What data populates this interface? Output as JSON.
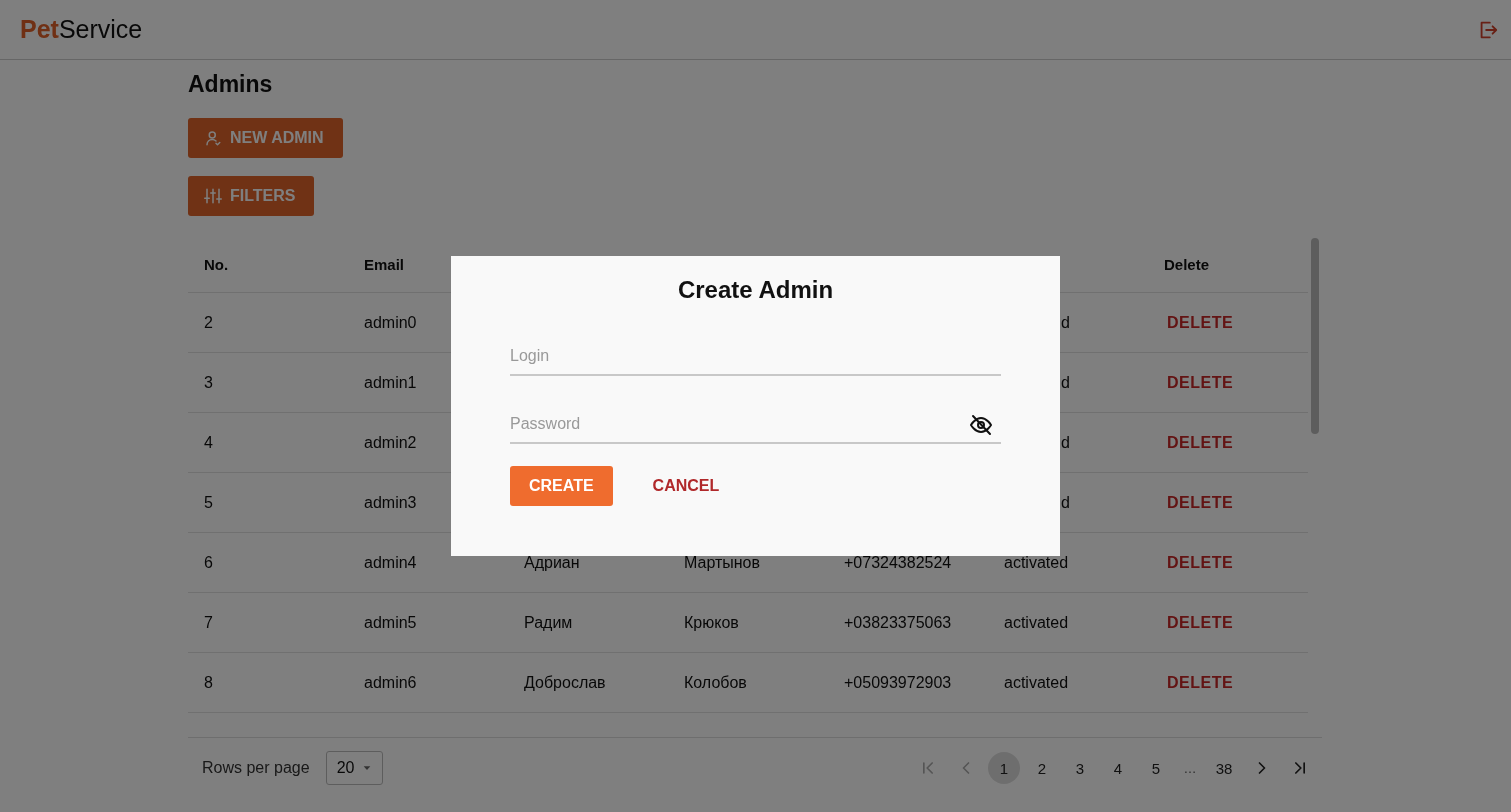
{
  "header": {
    "logo": {
      "accent": "Pet",
      "rest": "Service"
    }
  },
  "page_title": "Admins",
  "actions": [
    {
      "label": "NEW ADMIN",
      "kind": "add-user"
    },
    {
      "label": "FILTERS",
      "kind": "filters"
    }
  ],
  "table": {
    "columns": [
      {
        "label": "No."
      },
      {
        "label": "Email"
      },
      {},
      {},
      {},
      {},
      {
        "label": "Delete"
      }
    ],
    "rows": [
      {
        "cells": [
          "2",
          "admin0",
          null,
          null,
          null,
          {
            "text": "d",
            "tail": true
          }
        ],
        "action": "DELETE"
      },
      {
        "cells": [
          "3",
          "admin1",
          null,
          null,
          null,
          {
            "text": "d",
            "tail": true
          }
        ],
        "action": "DELETE"
      },
      {
        "cells": [
          "4",
          "admin2",
          null,
          null,
          null,
          {
            "text": "d",
            "tail": true
          }
        ],
        "action": "DELETE"
      },
      {
        "cells": [
          "5",
          "admin3",
          null,
          null,
          null,
          {
            "text": "d",
            "tail": true
          }
        ],
        "action": "DELETE"
      },
      {
        "cells": [
          "6",
          "admin4",
          "Адриан",
          "Мартынов",
          "+07324382524",
          "activated"
        ],
        "action": "DELETE"
      },
      {
        "cells": [
          "7",
          "admin5",
          "Радим",
          "Крюков",
          "+03823375063",
          "activated"
        ],
        "action": "DELETE"
      },
      {
        "cells": [
          "8",
          "admin6",
          "Доброслав",
          "Колобов",
          "+05093972903",
          "activated"
        ],
        "action": "DELETE"
      }
    ]
  },
  "footer": {
    "rows_per_page_label": "Rows per page",
    "rows_per_page": "20",
    "pages": [
      {
        "label": "1",
        "selected": true
      },
      {
        "label": "2",
        "selected": false
      },
      {
        "label": "3",
        "selected": false
      },
      {
        "label": "4",
        "selected": false
      },
      {
        "label": "5",
        "selected": false
      },
      {
        "label": "…",
        "kind": "ellipsis",
        "selected": false
      },
      {
        "label": "38",
        "selected": false
      }
    ]
  },
  "dialog": {
    "title": "Create Admin",
    "fields": [
      {
        "placeholder": "Login",
        "kind": "text"
      },
      {
        "placeholder": "Password",
        "kind": "password"
      }
    ],
    "buttons": [
      {
        "label": "CREATE",
        "kind": "primary"
      },
      {
        "label": "CANCEL",
        "kind": "text"
      }
    ]
  }
}
